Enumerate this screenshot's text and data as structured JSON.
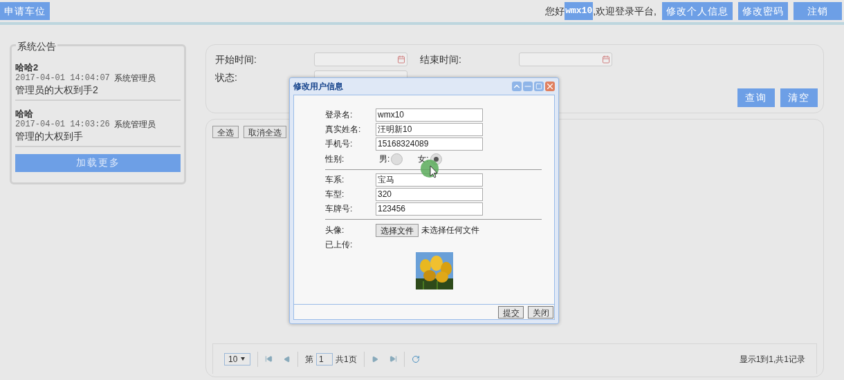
{
  "top_bar": {
    "apply_button": "申请车位",
    "greeting_prefix": "您好",
    "username": "wmx10",
    "greeting_suffix": ",欢迎登录平台,",
    "buttons": [
      "修改个人信息",
      "修改密码",
      "注销"
    ]
  },
  "notices": {
    "title": "系统公告",
    "items": [
      {
        "title": "哈哈2",
        "time": "2017-04-01 14:04:07",
        "author": "系统管理员",
        "content": "管理员的大权到手2"
      },
      {
        "title": "哈哈",
        "time": "2017-04-01 14:03:26",
        "author": "系统管理员",
        "content": "管理的大权到手"
      }
    ],
    "load_more": "加载更多"
  },
  "search": {
    "start_label": "开始时间:",
    "end_label": "结束时间:",
    "status_label": "状态:",
    "query_button": "查询",
    "clear_button": "清空"
  },
  "list": {
    "select_all": "全选",
    "deselect_all": "取消全选"
  },
  "pager": {
    "page_size": "10",
    "page_prefix": "第",
    "page": "1",
    "page_suffix": "共1页",
    "summary": "显示1到1,共1记录"
  },
  "dialog": {
    "title": "修改用户信息",
    "fields": [
      {
        "label": "登录名:",
        "value": "wmx10"
      },
      {
        "label": "真实姓名:",
        "value": "汪明新10"
      },
      {
        "label": "手机号:",
        "value": "15168324089"
      }
    ],
    "gender": {
      "label": "性别:",
      "options": [
        {
          "label": "男:",
          "selected": false
        },
        {
          "label": "女:",
          "selected": true
        }
      ]
    },
    "car_fields": [
      {
        "label": "车系:",
        "value": "宝马"
      },
      {
        "label": "车型:",
        "value": "320"
      },
      {
        "label": "车牌号:",
        "value": "123456"
      }
    ],
    "avatar_label": "头像:",
    "file_button": "选择文件",
    "file_status": "未选择任何文件",
    "uploaded_label": "已上传:",
    "avatar": {
      "kind": "picture"
    },
    "buttons": [
      "提交",
      "关闭"
    ]
  }
}
